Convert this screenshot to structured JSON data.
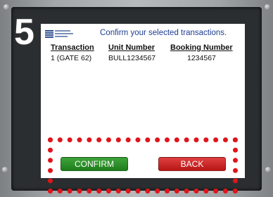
{
  "step": {
    "number": "5"
  },
  "screen": {
    "header": {
      "title": "Confirm your selected transactions.",
      "logo_icon": "port-authority-logo-icon"
    },
    "table": {
      "columns": [
        "Transaction",
        "Unit Number",
        "Booking Number"
      ],
      "rows": [
        [
          "1 (GATE 62)",
          "BULL1234567",
          "1234567"
        ]
      ]
    },
    "buttons": {
      "confirm_label": "CONFIRM",
      "back_label": "BACK"
    }
  },
  "colors": {
    "confirm": "#2b8f28",
    "back": "#d02424",
    "highlight": "#e0141b",
    "title": "#1e3d8f"
  }
}
